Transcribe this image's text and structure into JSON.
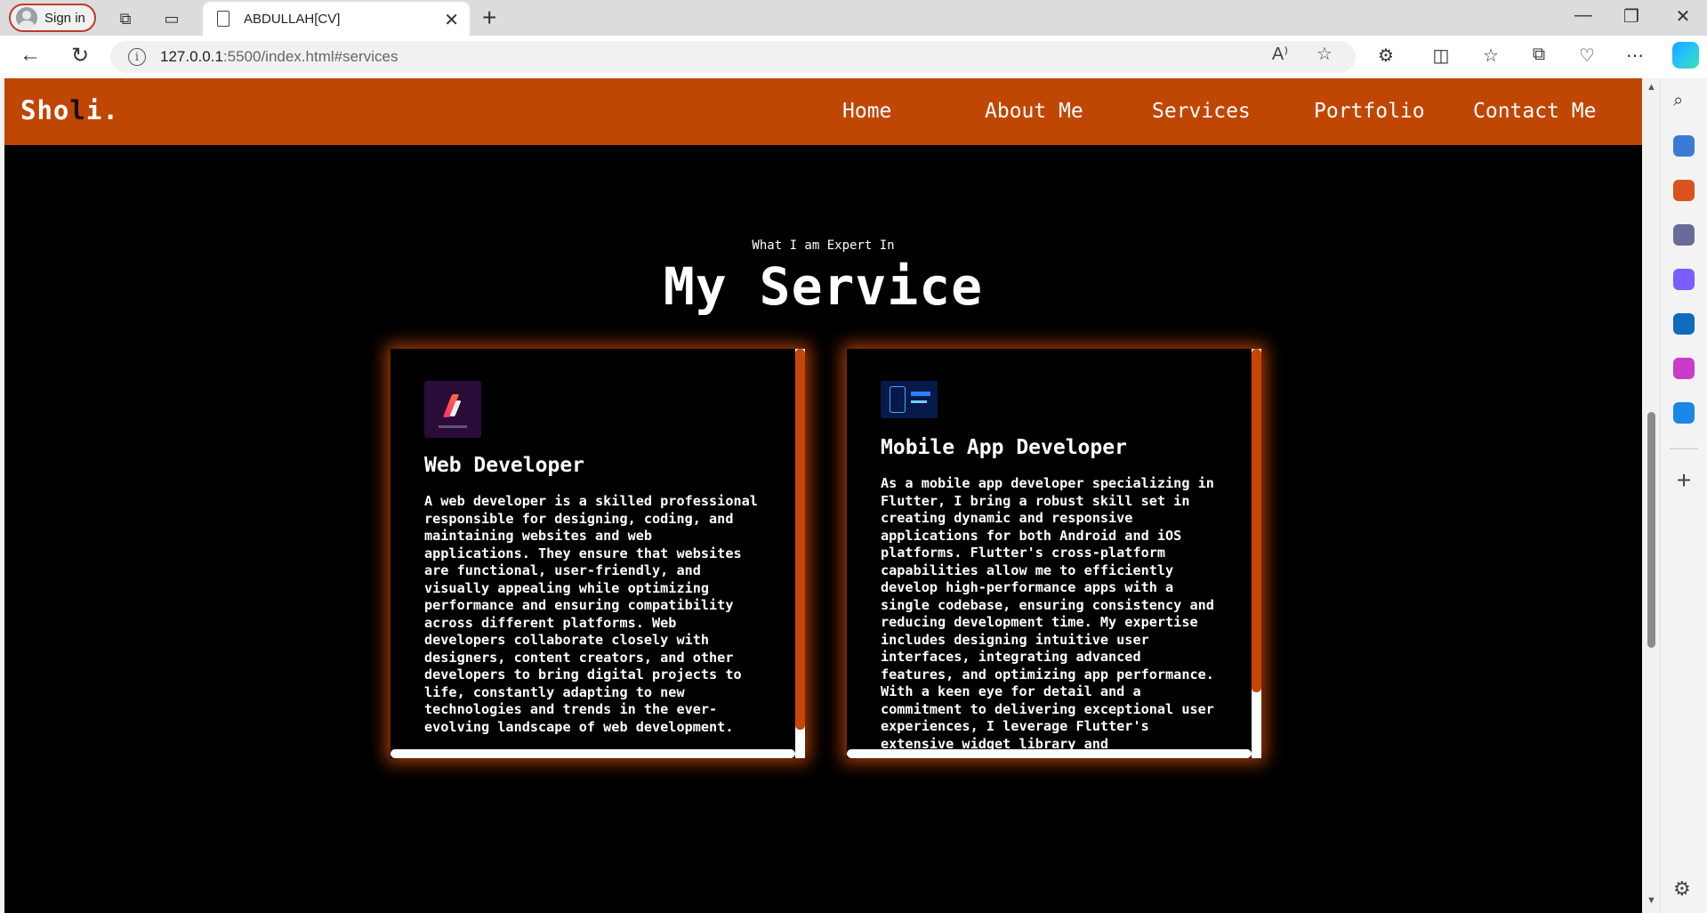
{
  "browser": {
    "sign_in_label": "Sign in",
    "tab_title": "ABDULLAH[CV]",
    "url_host": "127.0.0.1",
    "url_path": ":5500/index.html#services"
  },
  "site": {
    "logo": {
      "part1": "Sho",
      "part2": "l",
      "part3": "i."
    },
    "nav": [
      "Home",
      "About Me",
      "Services",
      "Portfolio",
      "Contact Me"
    ],
    "section_subtitle": "What I am Expert In",
    "section_title": "My Service",
    "cards": [
      {
        "title": "Web Developer",
        "text": "A web developer is a skilled professional responsible for designing, coding, and maintaining websites and web applications. They ensure that websites are functional, user-friendly, and visually appealing while optimizing performance and ensuring compatibility across different platforms. Web developers collaborate closely with designers, content creators, and other developers to bring digital projects to life, constantly adapting to new technologies and trends in the ever-evolving landscape of web development."
      },
      {
        "title": "Mobile App Developer",
        "text": "As a mobile app developer specializing in Flutter, I bring a robust skill set in creating dynamic and responsive applications for both Android and iOS platforms. Flutter's cross-platform capabilities allow me to efficiently develop high-performance apps with a single codebase, ensuring consistency and reducing development time. My expertise includes designing intuitive user interfaces, integrating advanced features, and optimizing app performance. With a keen eye for detail and a commitment to delivering exceptional user experiences, I leverage Flutter's extensive widget library and"
      }
    ]
  },
  "colors": {
    "brand": "#c04604",
    "background": "#000000",
    "card_glow": "#dc500a"
  }
}
